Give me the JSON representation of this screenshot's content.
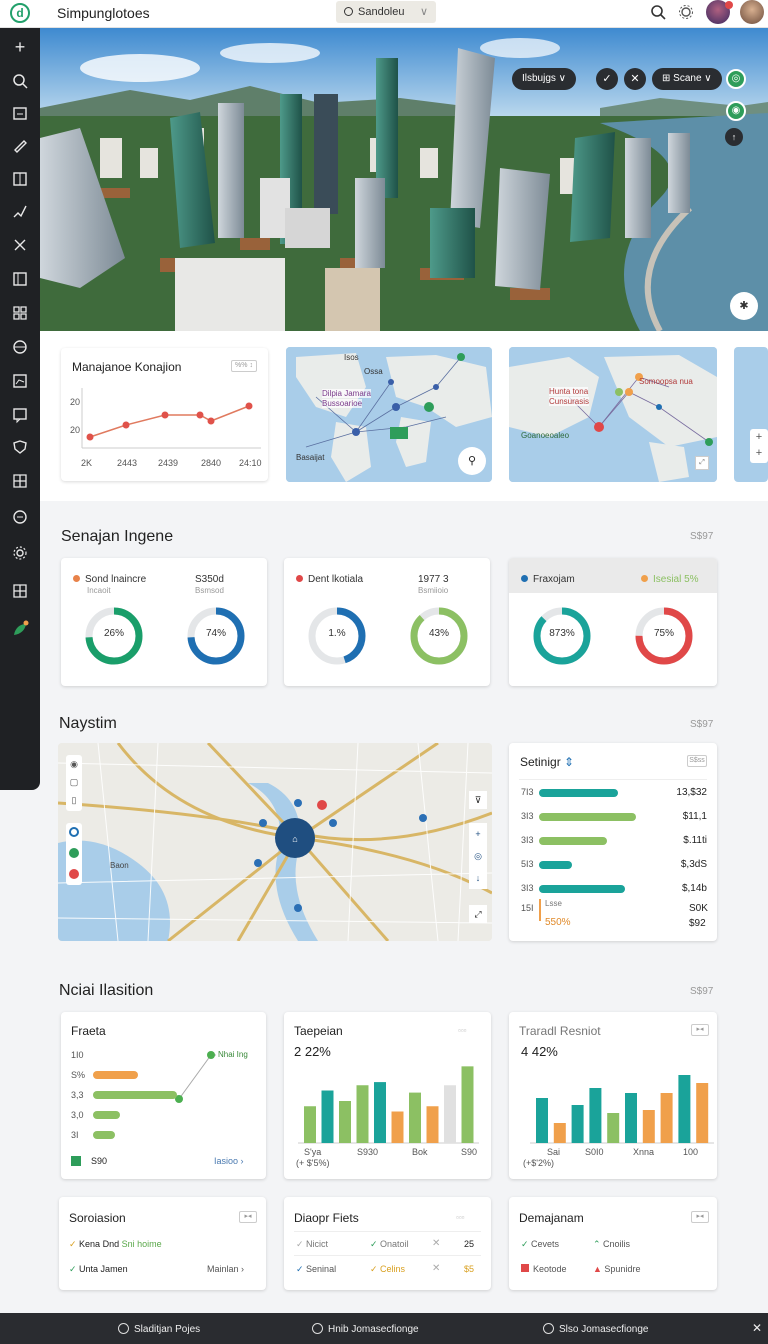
{
  "app": {
    "title": "Simpunglotoes",
    "logo_letter": "d"
  },
  "search": {
    "value": "Sandoleu"
  },
  "colors": {
    "accent": "#22a06b",
    "teal": "#1aa39a",
    "green": "#8cc063",
    "blue": "#1f6fb2",
    "orange": "#f0a04b",
    "red": "#e04848",
    "dark": "#1f2124"
  },
  "sidebar": {
    "icons": [
      "plus-icon",
      "search-icon",
      "folder-icon",
      "pen-icon",
      "book-icon",
      "brush-icon",
      "tools-icon",
      "building-icon",
      "grid-icon",
      "globe-icon",
      "chart-icon",
      "message-icon",
      "shield-icon",
      "layout-icon",
      "circle-icon",
      "settings-icon",
      "grid-2-icon",
      "leaf-icon"
    ]
  },
  "hero": {
    "chip_left": "Ilsbujgs",
    "chip_right": "Scane"
  },
  "line_card": {
    "title": "Manajanoe Konajion",
    "button": "%% ↕",
    "y_labels": [
      "20",
      "20"
    ],
    "x_labels": [
      "2K",
      "2443",
      "2439",
      "2840",
      "24:10"
    ]
  },
  "map_cards": {
    "one": {
      "label1": "Isos",
      "label2": "Ossa",
      "label3": "Dilpia Jamara",
      "label4": "Bussoarioe",
      "footer": "Basaijat"
    },
    "two": {
      "label1": "Hunta tona",
      "label2": "Cunsurasis",
      "label3": "Somoopsa nua",
      "label4": "Goanoeoaleo"
    }
  },
  "section1": {
    "title": "Senajan Ingene",
    "meta": "S$97",
    "cards": [
      {
        "label": "Sond lnaincre",
        "sub": "Incaoit",
        "value": "S350d",
        "value_sub": "Bsmsod",
        "dot": "#e8824a",
        "d1": "26%",
        "d1_pct": 0.74,
        "d1_color": "#1a9e6a",
        "d2": "74%",
        "d2_pct": 0.74,
        "d2_color": "#1f6fb2"
      },
      {
        "label": "Dent lkotiala",
        "sub": "",
        "value": "1977 3",
        "value_sub": "Bsmiioio",
        "dot": "#e04848",
        "d1": "1.%",
        "d1_pct": 0.45,
        "d1_color": "#1f6fb2",
        "d2": "43%",
        "d2_pct": 0.88,
        "d2_color": "#8cc063"
      },
      {
        "label": "Fraxojam",
        "sub": "",
        "value": "Isesial 5%",
        "value_sub": "",
        "dot": "#1f6fb2",
        "dot2": "#f0a04b",
        "d1": "873%",
        "d1_pct": 0.87,
        "d1_color": "#1aa39a",
        "d2": "75%",
        "d2_pct": 0.75,
        "d2_color": "#e04848"
      }
    ]
  },
  "section2": {
    "title": "Naystim",
    "meta": "S$97",
    "map_label": "Baon",
    "panel": {
      "title": "Setinigr",
      "button": "S$ss",
      "rows": [
        {
          "label": "7I3",
          "value": "13,$32",
          "pct": 0.75,
          "color": "#1aa39a"
        },
        {
          "label": "3I3",
          "value": "$11,1",
          "pct": 0.92,
          "color": "#8cc063"
        },
        {
          "label": "3I3",
          "value": "$.11ti",
          "pct": 0.65,
          "color": "#8cc063"
        },
        {
          "label": "5I3",
          "value": "$,3dS",
          "pct": 0.31,
          "color": "#1aa39a"
        },
        {
          "label": "3I3",
          "value": "$,14b",
          "pct": 0.82,
          "color": "#1aa39a"
        }
      ],
      "footer_label": "15I",
      "footer_sub": "Lsse",
      "footer_pct": "550%",
      "footer_v1": "S0K",
      "footer_v2": "$92"
    }
  },
  "section3": {
    "title": "Nciai Ilasition",
    "meta": "S$97",
    "card1": {
      "title": "Fraeta",
      "callout": "Nhai Ing",
      "labels": [
        "1I0",
        "S%",
        "3,3",
        "3,0",
        "3I"
      ],
      "pcts": [
        0,
        0.4,
        0.75,
        0.24,
        0.2
      ],
      "colors": [
        "#ffffff",
        "#f0a04b",
        "#8cc063",
        "#8cc063",
        "#8cc063"
      ],
      "footer": "S90",
      "footer_link": "Iasioo"
    },
    "card2": {
      "title": "Taepeian",
      "value": "2 22%",
      "bars": [
        0.35,
        0.5,
        0.4,
        0.55,
        0.58,
        0.3,
        0.48,
        0.35,
        0.55,
        0.73
      ],
      "colors": [
        "#8cc063",
        "#1aa39a",
        "#8cc063",
        "#8cc063",
        "#1aa39a",
        "#f0a04b",
        "#8cc063",
        "#f0a04b",
        "#e0e0e0",
        "#8cc063"
      ],
      "x_labels": [
        "S'ya",
        "S930",
        "Bok",
        "S90"
      ],
      "sub": "(+ $'5%)"
    },
    "card3": {
      "title": "Traradl Resniot",
      "value": "4 42%",
      "bars": [
        0.45,
        0.2,
        0.38,
        0.55,
        0.3,
        0.5,
        0.33,
        0.5,
        0.68,
        0.6
      ],
      "colors": [
        "#1aa39a",
        "#f0a04b",
        "#1aa39a",
        "#1aa39a",
        "#8cc063",
        "#1aa39a",
        "#f0a04b",
        "#f0a04b",
        "#1aa39a",
        "#f0a04b"
      ],
      "x_labels": [
        "Sai",
        "S0I0",
        "Xnna",
        "100"
      ],
      "sub": "(+$'2%)"
    }
  },
  "section4": {
    "card1": {
      "title": "Soroiasion",
      "row1": "Kena Dnd",
      "row1_accent": "Sni hoime",
      "row2": "Unta Jamen",
      "row2_link": "Mainlan"
    },
    "card2": {
      "title": "Diaopr Fiets",
      "r1a": "Nicict",
      "r1b": "Onatoil",
      "r1c": "25",
      "r2a": "Seninal",
      "r2b": "Celins",
      "r2c": "$5"
    },
    "card3": {
      "title": "Demajanam",
      "r1a": "Cevets",
      "r1b": "Cnoilis",
      "r2a": "Keotode",
      "r2b": "Spunidre"
    }
  },
  "bottom": {
    "items": [
      "Sladitjan Pojes",
      "Hnib Jomasecfionge",
      "Slso Jomasecfionge"
    ]
  }
}
